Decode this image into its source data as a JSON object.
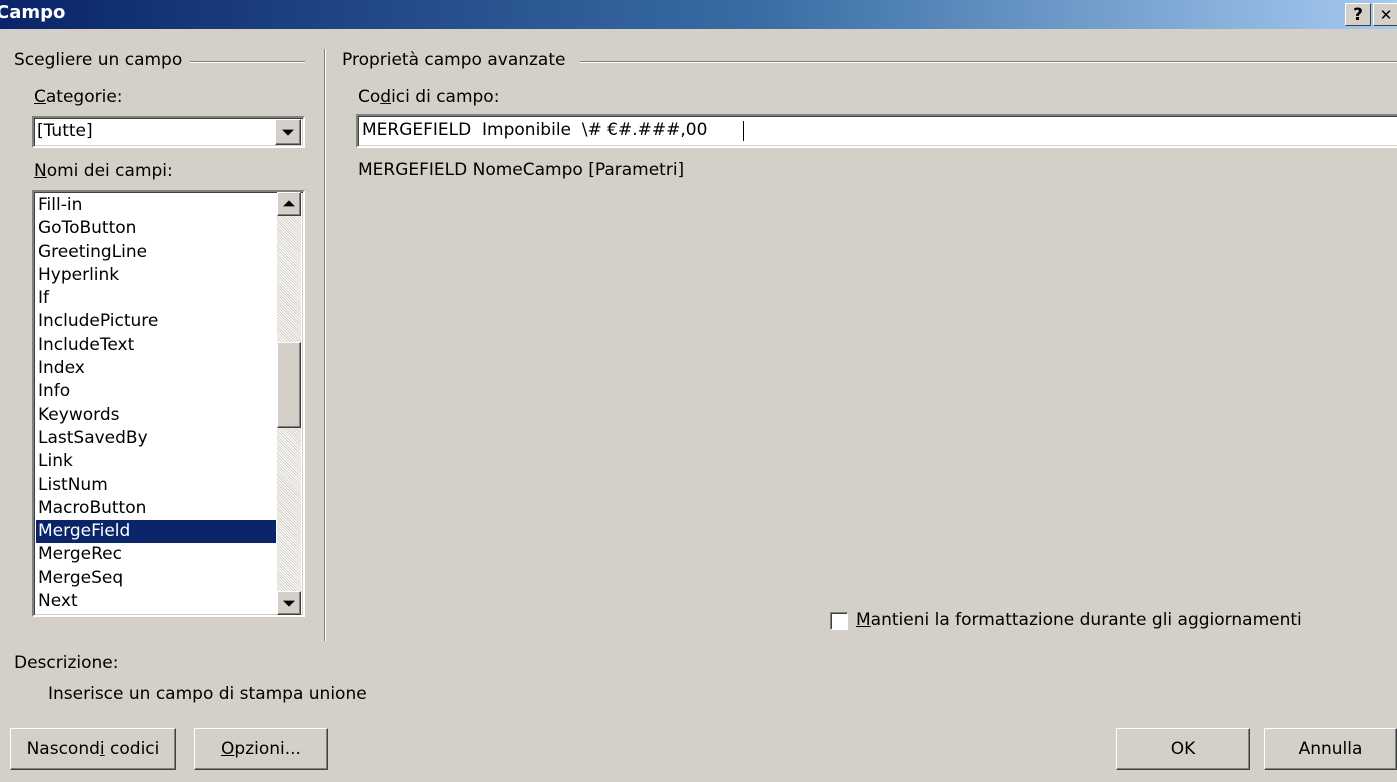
{
  "window": {
    "title": "Campo",
    "help_button": "?",
    "close_button": "✕"
  },
  "left_group": {
    "heading": "Scegliere un campo",
    "categories_label_prefix": "",
    "categories_label_accel": "C",
    "categories_label_rest": "ategorie:",
    "categories_selected": "[Tutte]",
    "field_names_label_accel": "N",
    "field_names_label_rest": "omi dei campi:",
    "field_names": [
      "Fill-in",
      "GoToButton",
      "GreetingLine",
      "Hyperlink",
      "If",
      "IncludePicture",
      "IncludeText",
      "Index",
      "Info",
      "Keywords",
      "LastSavedBy",
      "Link",
      "ListNum",
      "MacroButton",
      "MergeField",
      "MergeRec",
      "MergeSeq",
      "Next"
    ],
    "selected_field": "MergeField"
  },
  "right_group": {
    "heading": "Proprietà campo avanzate",
    "codes_label_pre": "Co",
    "codes_label_accel": "d",
    "codes_label_rest": "ici di campo:",
    "codes_value": "MERGEFIELD  Imponibile  \\# €#.###,00",
    "syntax_hint": "MERGEFIELD NomeCampo [Parametri]",
    "preserve_format_accel": "M",
    "preserve_format_rest": "antieni la formattazione durante gli aggiornamenti",
    "preserve_format_checked": false
  },
  "description": {
    "label": "Descrizione:",
    "text": "Inserisce un campo di stampa unione"
  },
  "buttons": {
    "hide_codes_pre": "Nascond",
    "hide_codes_accel": "i",
    "hide_codes_rest": " codici",
    "options_accel": "O",
    "options_rest": "pzioni...",
    "ok": "OK",
    "cancel": "Annulla"
  },
  "colors": {
    "dialog_bg": "#d4d0c8",
    "title_bar_start": "#0a246a",
    "title_bar_end": "#a6caf0",
    "selection": "#0a246a"
  }
}
